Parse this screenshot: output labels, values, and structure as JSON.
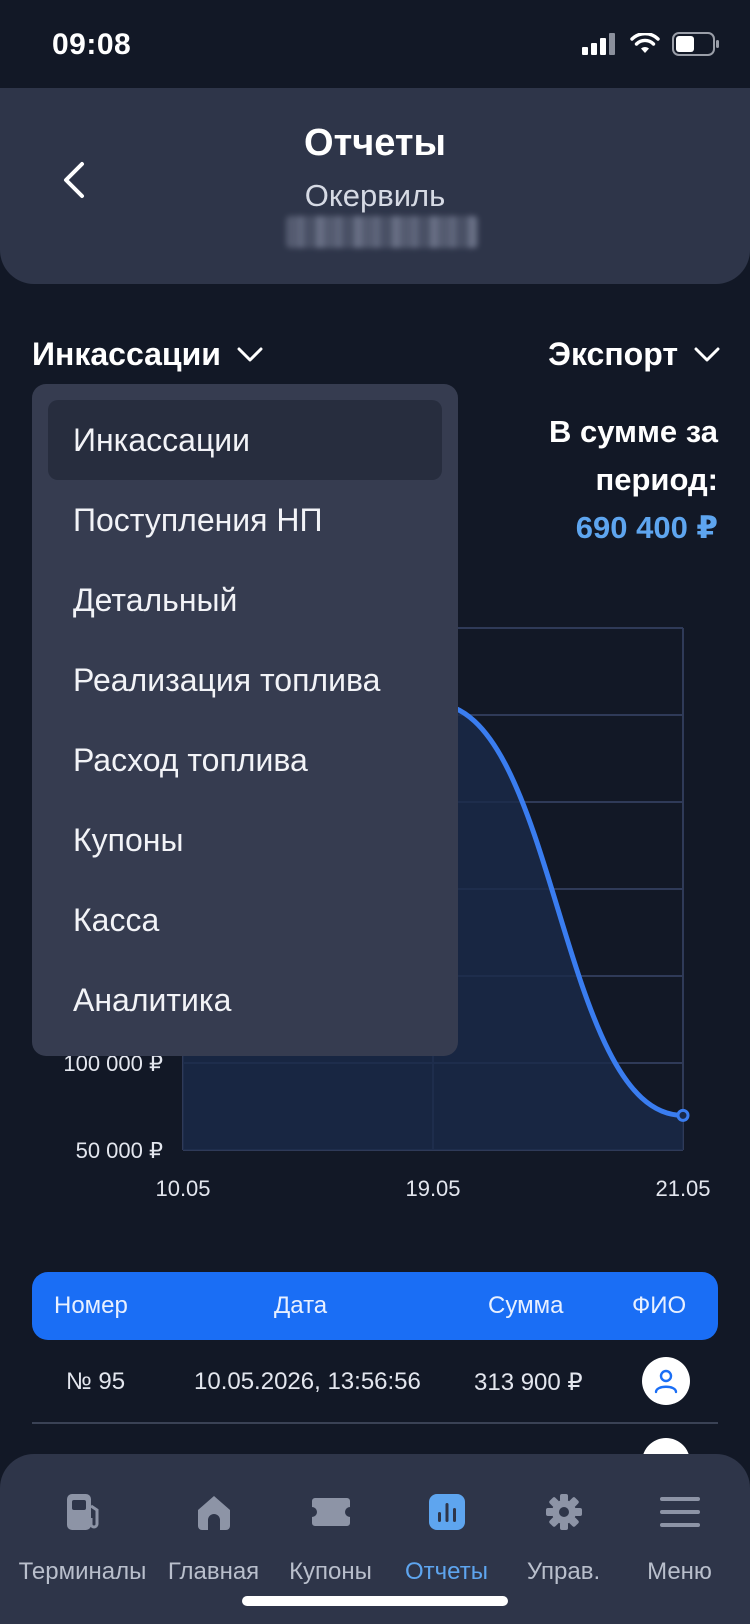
{
  "status": {
    "time": "09:08",
    "battery": "low"
  },
  "header": {
    "title": "Отчеты",
    "subtitle": "Окервиль"
  },
  "report_selector": {
    "selected": "Инкассации"
  },
  "export_selector": {
    "label": "Экспорт"
  },
  "summary": {
    "label": "В сумме за период:",
    "value": "690 400 ₽"
  },
  "dropdown": {
    "items": [
      "Инкассации",
      "Поступления НП",
      "Детальный",
      "Реализация топлива",
      "Расход топлива",
      "Купоны",
      "Касса",
      "Аналитика"
    ],
    "selected_index": 0
  },
  "chart_data": {
    "type": "area",
    "x": [
      "10.05",
      "19.05",
      "21.05"
    ],
    "y_tick_labels_visible": [
      "50 000 ₽",
      "100 000 ₽"
    ],
    "ylim": [
      50000,
      350000
    ],
    "series": [
      {
        "values": [
          313900,
          306600,
          69900
        ],
        "color": "#3a7df0"
      }
    ],
    "grid": true
  },
  "table": {
    "columns": [
      "Номер",
      "Дата",
      "Сумма",
      "ФИО"
    ],
    "rows": [
      {
        "number": "№ 95",
        "date": "10.05.2026, 13:56:56",
        "sum": "313 900 ₽"
      }
    ]
  },
  "tabbar": {
    "items": [
      {
        "label": "Терминалы",
        "icon": "fuel-pump-icon"
      },
      {
        "label": "Главная",
        "icon": "home-icon"
      },
      {
        "label": "Купоны",
        "icon": "coupon-icon"
      },
      {
        "label": "Отчеты",
        "icon": "chart-icon"
      },
      {
        "label": "Управ.",
        "icon": "gear-icon"
      },
      {
        "label": "Меню",
        "icon": "menu-icon"
      }
    ],
    "active_index": 3
  },
  "colors": {
    "accent": "#1a6ef5",
    "highlight": "#5ea5ef",
    "background": "#121826",
    "panel": "#2e3549"
  }
}
